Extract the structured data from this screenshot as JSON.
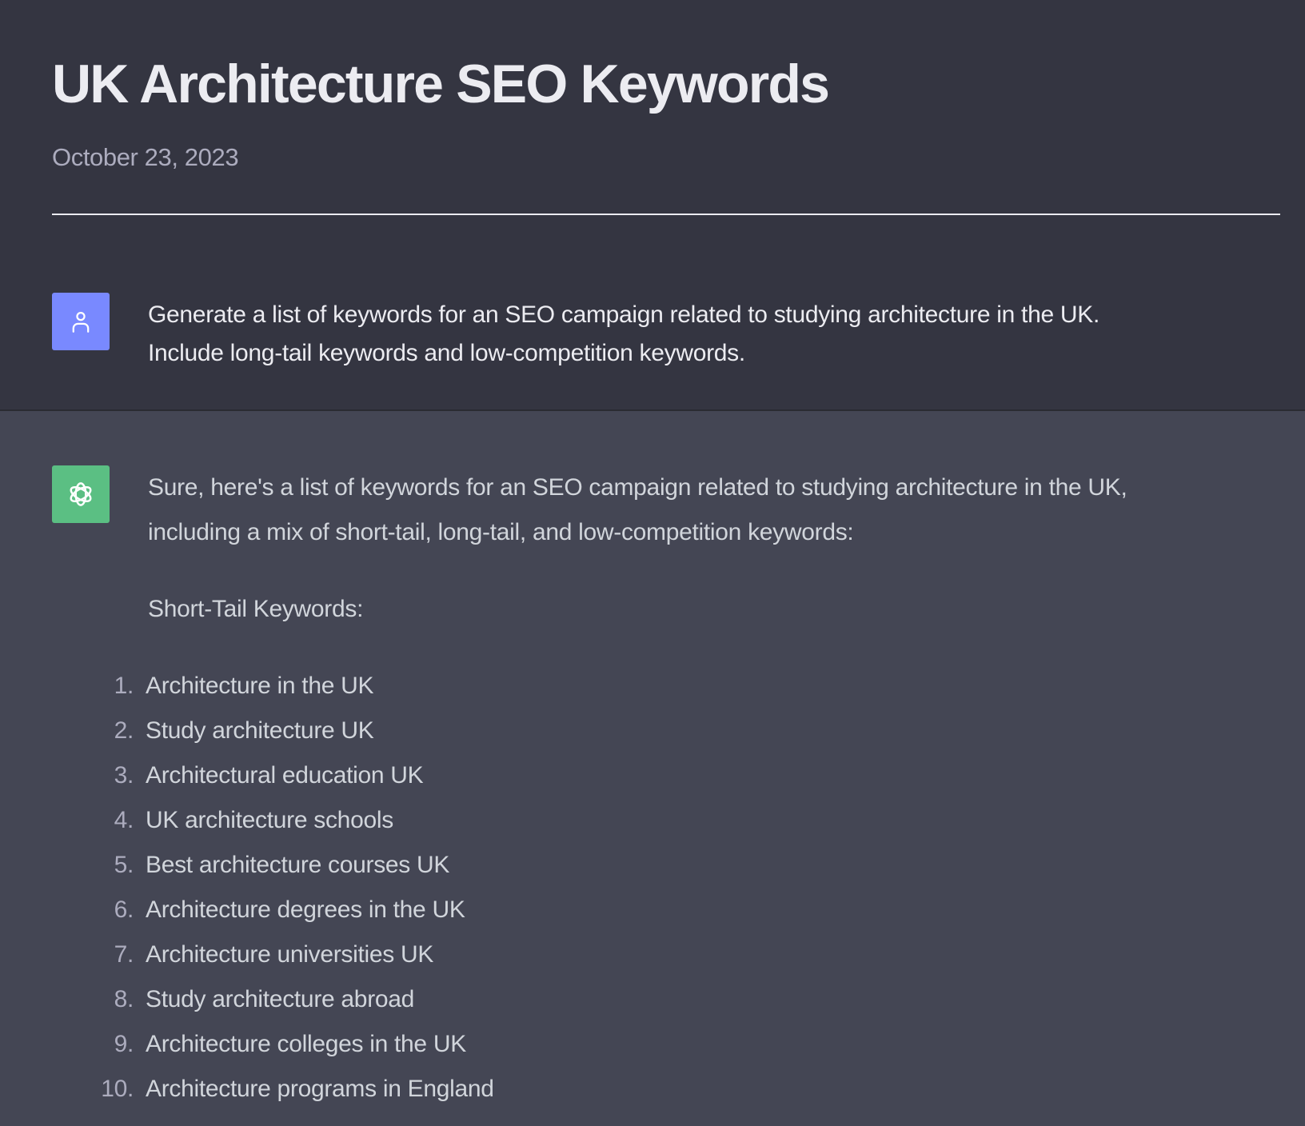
{
  "page": {
    "title": "UK Architecture SEO Keywords",
    "date": "October 23, 2023"
  },
  "colors": {
    "user_avatar": "#7989FF",
    "assistant_avatar": "#5BBF83",
    "header_bg": "#343541",
    "assistant_bg": "#444654"
  },
  "conversation": {
    "user_message": {
      "avatar_icon": "user-icon",
      "lines": [
        "Generate a list of keywords for an SEO campaign related to studying architecture in the UK.",
        "Include long-tail keywords and low-competition keywords."
      ]
    },
    "assistant_message": {
      "avatar_icon": "openai-logo-icon",
      "intro": "Sure, here's a list of keywords for an SEO campaign related to studying architecture in the UK, including a mix of short-tail, long-tail, and low-competition keywords:",
      "section_label": "Short-Tail Keywords:",
      "keywords": [
        {
          "num": "1.",
          "text": "Architecture in the UK"
        },
        {
          "num": "2.",
          "text": "Study architecture UK"
        },
        {
          "num": "3.",
          "text": "Architectural education UK"
        },
        {
          "num": "4.",
          "text": "UK architecture schools"
        },
        {
          "num": "5.",
          "text": "Best architecture courses UK"
        },
        {
          "num": "6.",
          "text": "Architecture degrees in the UK"
        },
        {
          "num": "7.",
          "text": "Architecture universities UK"
        },
        {
          "num": "8.",
          "text": "Study architecture abroad"
        },
        {
          "num": "9.",
          "text": "Architecture colleges in the UK"
        },
        {
          "num": "10.",
          "text": "Architecture programs in England"
        }
      ]
    }
  }
}
